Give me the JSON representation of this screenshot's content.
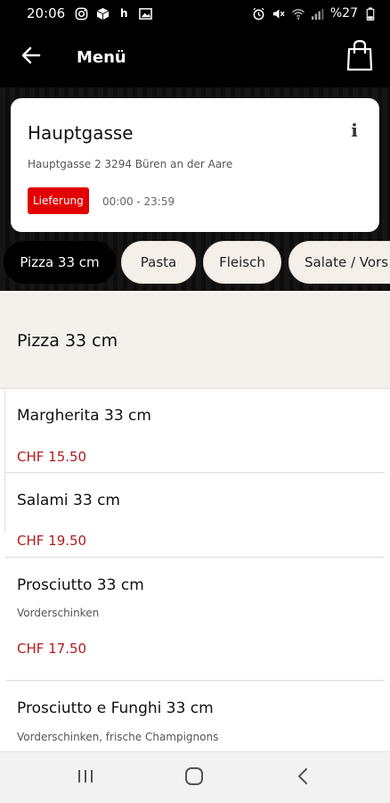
{
  "status_bar": {
    "time": "20:06",
    "left_icons": [
      "instagram-icon",
      "package-icon",
      "h-icon",
      "image-icon"
    ],
    "h_label": "h",
    "battery_text": "%27",
    "right_icons": [
      "alarm-icon",
      "mute-icon",
      "wifi-icon",
      "signal-icon",
      "battery-icon"
    ]
  },
  "app_bar": {
    "title": "Menü",
    "back_icon": "arrow-left-icon",
    "cart_icon": "shopping-bag-icon"
  },
  "store": {
    "name": "Hauptgasse",
    "address": "Hauptgasse 2 3294 Büren an der Aare",
    "badge": "Lieferung",
    "hours": "00:00 - 23:59",
    "info_label": "i",
    "badge_color": "#e20000"
  },
  "tabs": [
    {
      "label": "Pizza 33 cm",
      "active": true
    },
    {
      "label": "Pasta",
      "active": false
    },
    {
      "label": "Fleisch",
      "active": false
    },
    {
      "label": "Salate / Vors",
      "active": false
    }
  ],
  "section": {
    "title": "Pizza 33 cm"
  },
  "items": [
    {
      "name": "Margherita 33 cm",
      "desc": "",
      "price": "CHF 15.50"
    },
    {
      "name": "Salami 33 cm",
      "desc": "",
      "price": "CHF 19.50"
    },
    {
      "name": "Prosciutto 33 cm",
      "desc": "Vorderschinken",
      "price": "CHF 17.50"
    },
    {
      "name": "Prosciutto e Funghi 33 cm",
      "desc": "Vorderschinken, frische Champignons",
      "price": ""
    }
  ],
  "colors": {
    "price": "#b01c1c",
    "app_bar": "#000000",
    "section_bg": "#f4f0ec"
  },
  "nav_bar": {
    "buttons": [
      "recent-apps-icon",
      "home-icon",
      "back-icon"
    ]
  }
}
